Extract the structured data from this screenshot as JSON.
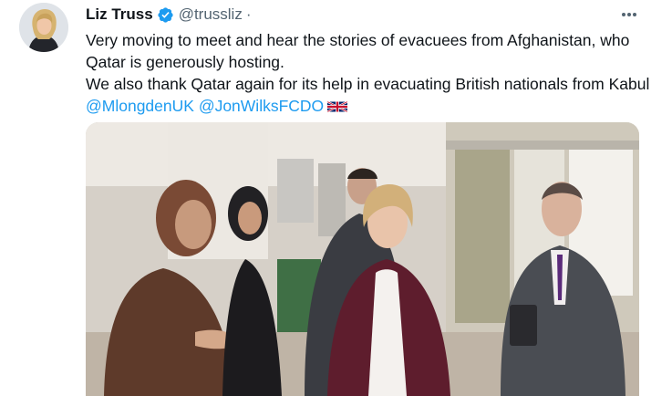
{
  "tweet": {
    "author_name": "Liz Truss",
    "author_handle": "@trussliz",
    "separator": "·",
    "avatar_icon": "profile-photo",
    "verified_icon": "verified-badge-icon",
    "more_icon": "more-options-icon",
    "text_line1": "Very moving to meet and hear the stories of evacuees from Afghanistan, who Qatar is generously hosting.",
    "text_line2_part1": "We also thank Qatar again for its help in evacuating British nationals from Kabul ",
    "mention1": "@MlongdenUK",
    "mention2": "@JonWilksFCDO",
    "flag_icon": "uk-flag-emoji",
    "image_alt": "Photo of Liz Truss with officials in a building"
  },
  "colors": {
    "accent": "#1d9bf0",
    "text": "#0f1419",
    "muted": "#536471"
  }
}
